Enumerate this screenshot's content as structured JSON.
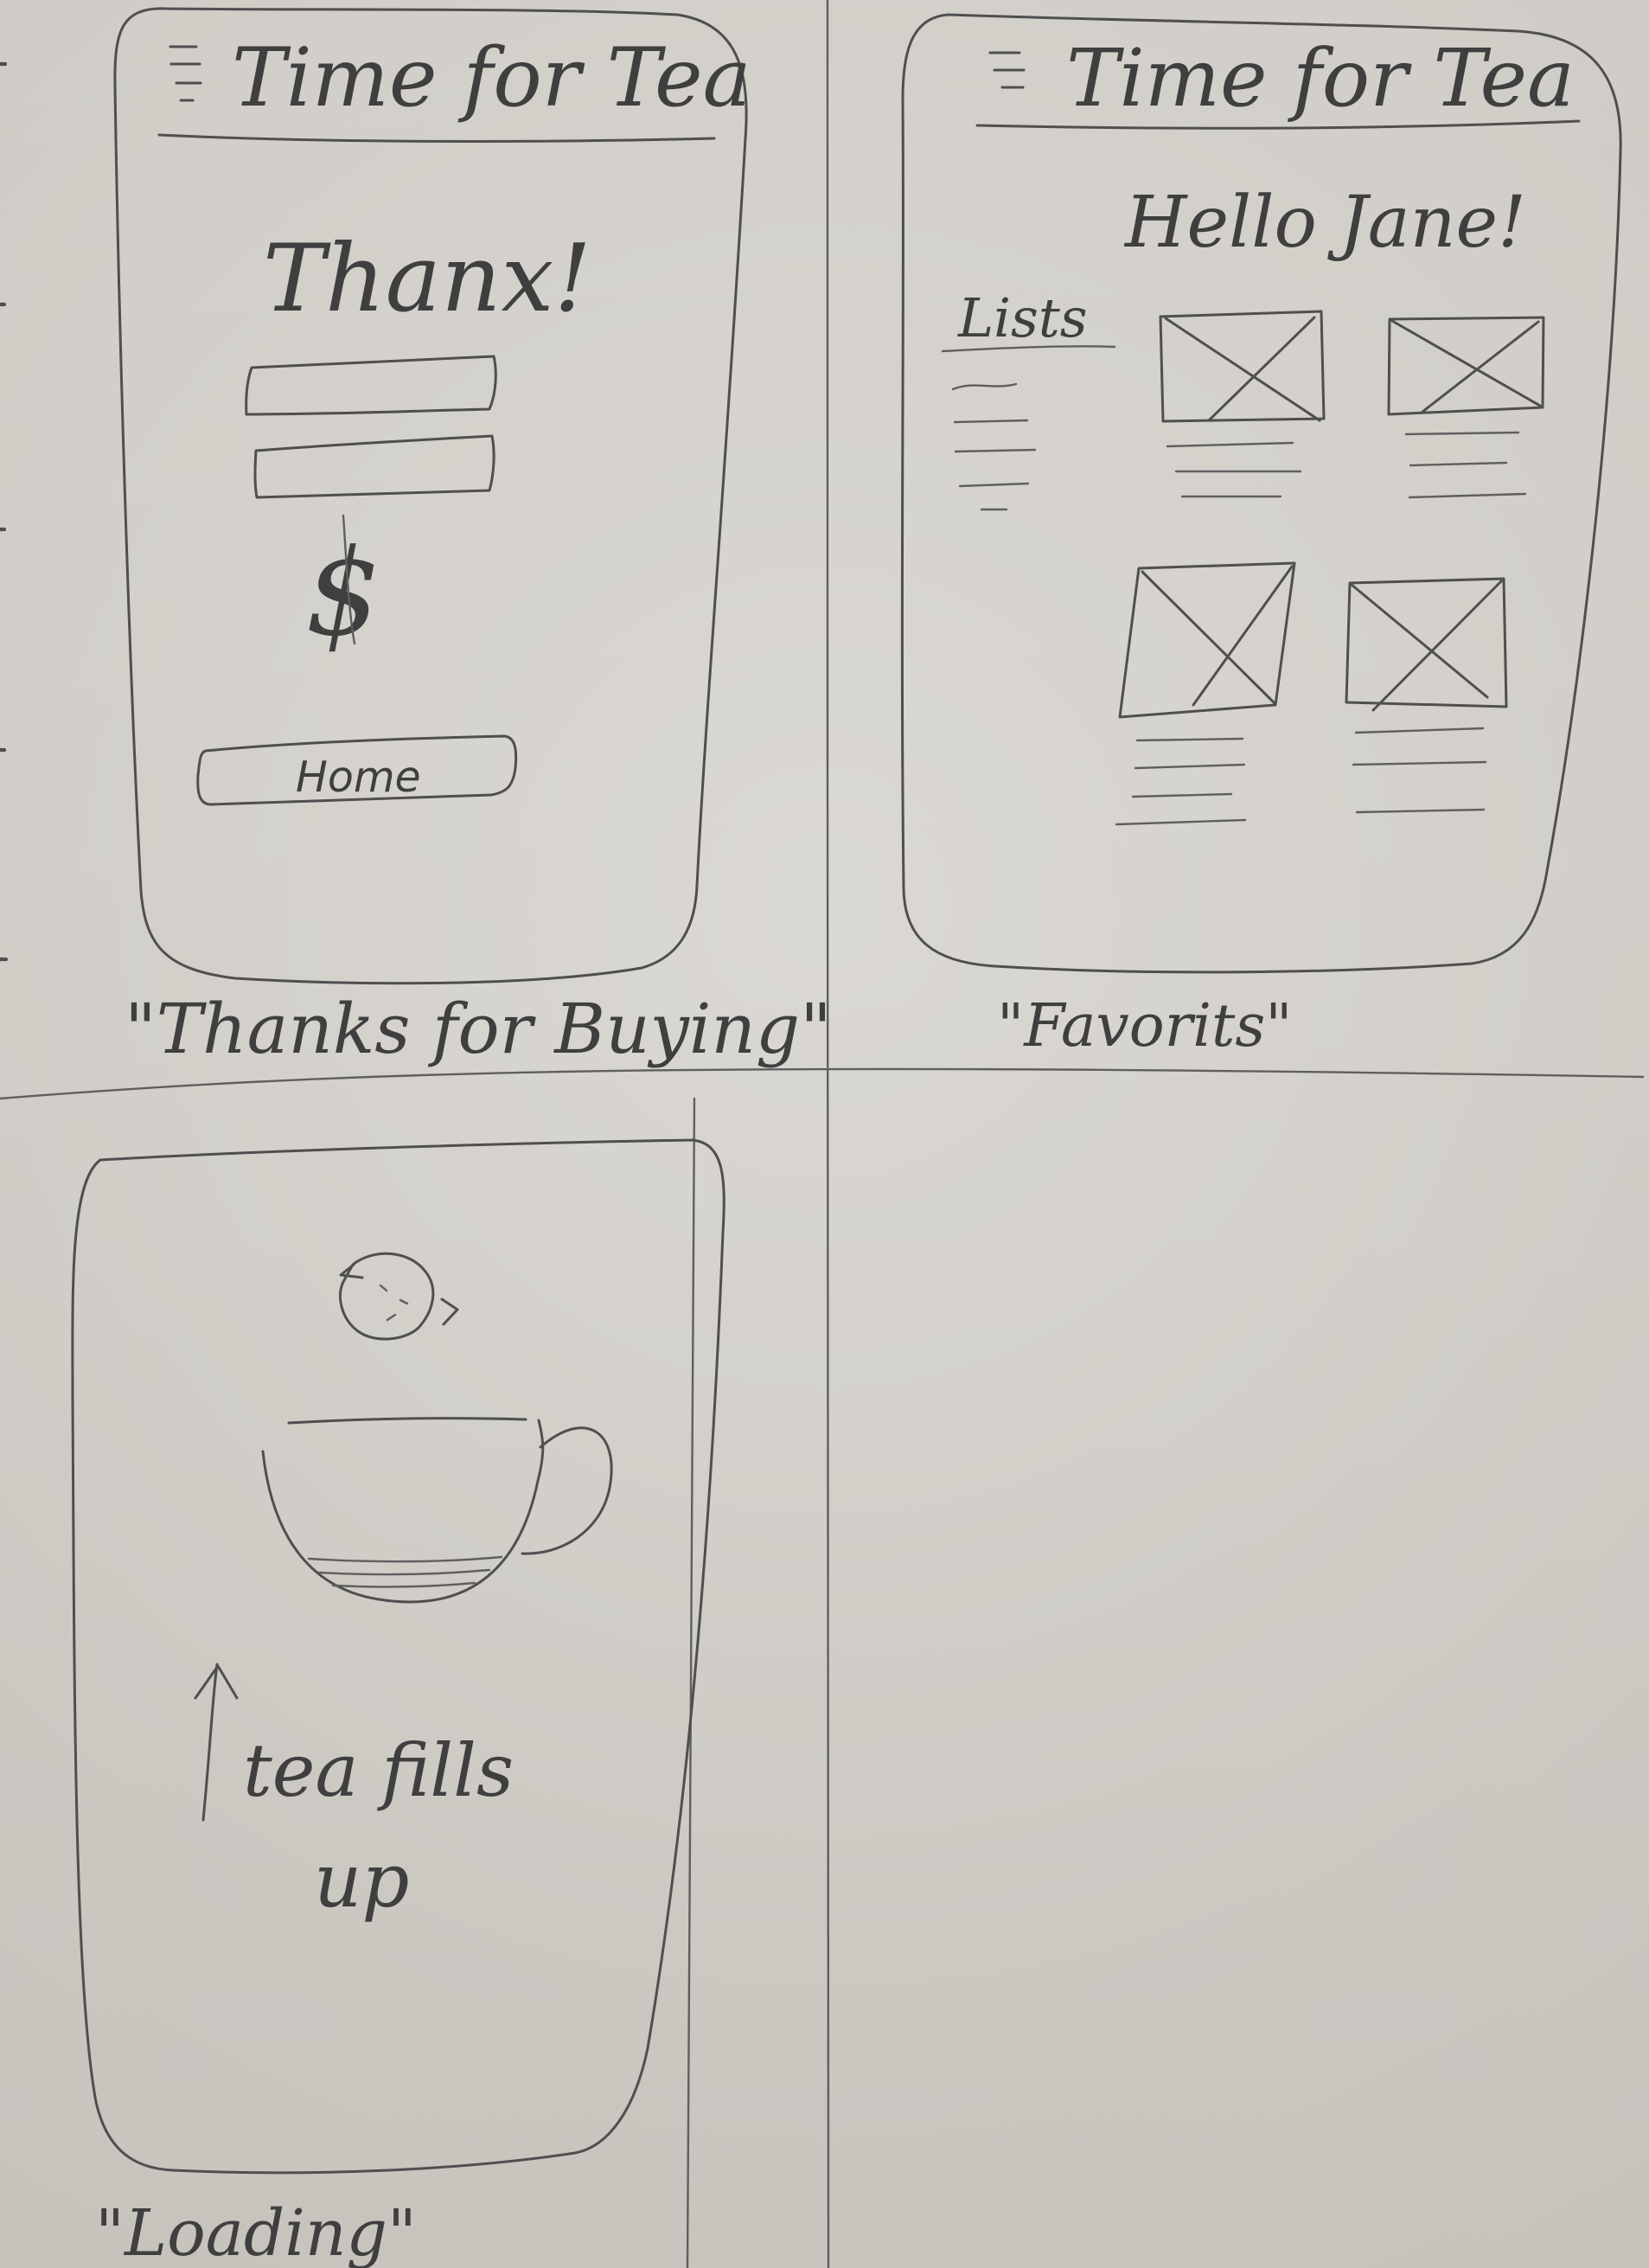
{
  "sketches": {
    "thanks": {
      "header": {
        "title": "Time for Tea"
      },
      "message": "Thanx!",
      "currency_symbol": "$",
      "home_button": "Home",
      "caption": "\"Thanks for Buying\""
    },
    "favorites": {
      "header": {
        "title": "Time for Tea"
      },
      "greeting": "Hello Jane!",
      "lists_label": "Lists",
      "caption": "\"Favorits\""
    },
    "loading": {
      "note_line1": "tea fills",
      "note_line2": "up",
      "caption": "\"Loading\""
    }
  },
  "icons": {
    "menu": "hamburger-menu-icon",
    "refresh": "refresh-icon",
    "cup": "teacup-icon",
    "arrow": "up-arrow-icon"
  }
}
